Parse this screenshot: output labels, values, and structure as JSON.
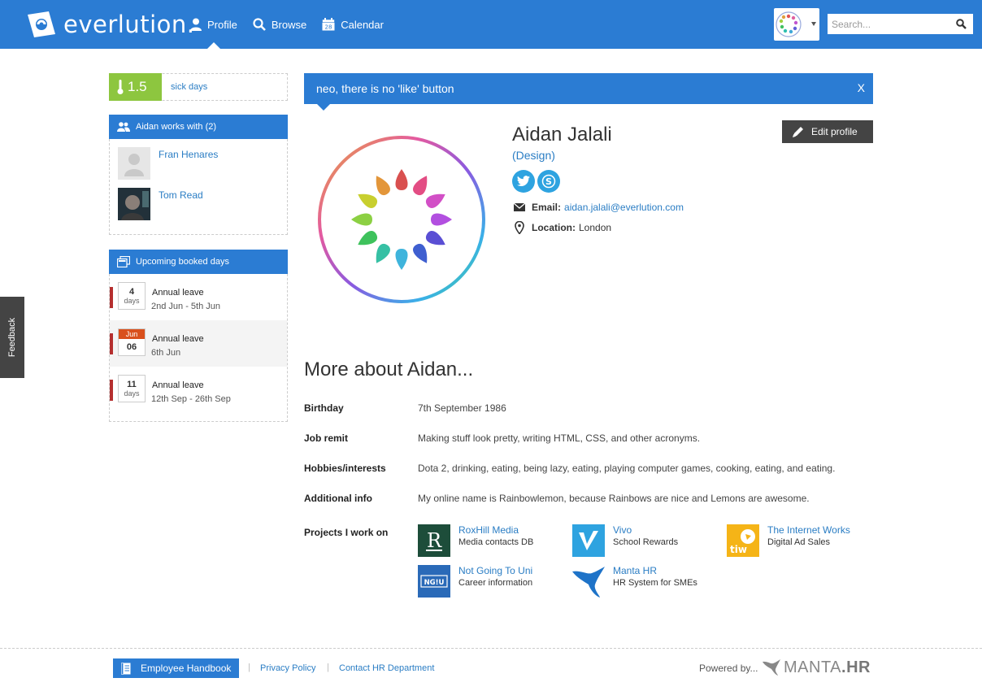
{
  "header": {
    "brand": "everlution.",
    "nav": [
      {
        "label": "Profile",
        "icon": "user-icon",
        "active": true
      },
      {
        "label": "Browse",
        "icon": "search-icon",
        "active": false
      },
      {
        "label": "Calendar",
        "icon": "calendar-icon",
        "active": false
      }
    ],
    "search_placeholder": "Search..."
  },
  "sidebar": {
    "sick_days": {
      "value": "1.5",
      "label": "sick days"
    },
    "works_with": {
      "title": "Aidan works with (2)",
      "people": [
        {
          "name": "Fran Henares"
        },
        {
          "name": "Tom Read"
        }
      ]
    },
    "upcoming": {
      "title": "Upcoming booked days",
      "items": [
        {
          "num": "4",
          "unit": "days",
          "type": "Annual leave",
          "dates": "2nd Jun - 5th Jun"
        },
        {
          "month": "Jun",
          "num": "06",
          "type": "Annual leave",
          "dates": "6th Jun"
        },
        {
          "num": "11",
          "unit": "days",
          "type": "Annual leave",
          "dates": "12th Sep - 26th Sep"
        }
      ]
    }
  },
  "feedback": "Feedback",
  "notice": {
    "text": "neo, there is no 'like' button",
    "close": "X"
  },
  "profile": {
    "name": "Aidan Jalali",
    "department": "(Design)",
    "email_label": "Email:",
    "email": "aidan.jalali@everlution.com",
    "location_label": "Location:",
    "location": "London",
    "edit_label": "Edit profile"
  },
  "more": {
    "title": "More about Aidan...",
    "rows": [
      {
        "key": "Birthday",
        "value": "7th September 1986"
      },
      {
        "key": "Job remit",
        "value": "Making stuff look pretty, writing HTML, CSS, and other acronyms."
      },
      {
        "key": "Hobbies/interests",
        "value": "Dota 2, drinking, eating, being lazy, eating, playing computer games, cooking, eating, and eating."
      },
      {
        "key": "Additional info",
        "value": "My online name is Rainbowlemon, because Rainbows are nice and Lemons are awesome."
      }
    ],
    "projects_label": "Projects I work on",
    "projects": [
      {
        "name": "RoxHill Media",
        "desc": "Media contacts DB",
        "logo_text": "R"
      },
      {
        "name": "Vivo",
        "desc": "School Rewards",
        "logo_text": ""
      },
      {
        "name": "The Internet Works",
        "desc": "Digital Ad Sales",
        "logo_text": "tiw"
      },
      {
        "name": "Not Going To Uni",
        "desc": "Career information",
        "logo_text": "NG!U"
      },
      {
        "name": "Manta HR",
        "desc": "HR System for SMEs",
        "logo_text": ""
      }
    ]
  },
  "footer": {
    "handbook": "Employee Handbook",
    "sep": "|",
    "privacy": "Privacy Policy",
    "contact": "Contact HR Department",
    "powered": "Powered by...",
    "brand_a": "MANTA",
    "brand_b": ".HR"
  }
}
